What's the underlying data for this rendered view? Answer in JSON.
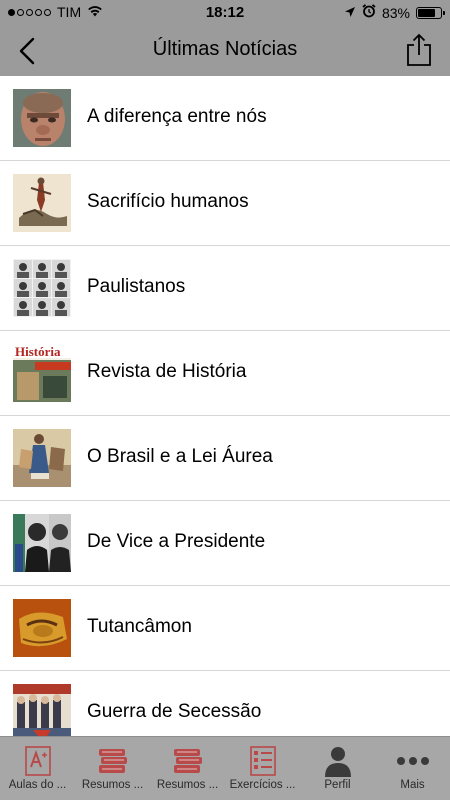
{
  "status_bar": {
    "carrier": "TIM",
    "time": "18:12",
    "battery_percent": "83%",
    "battery_level": 0.83,
    "signal_bars_filled": 1,
    "signal_bars_total": 5
  },
  "nav": {
    "title": "Últimas Notícias",
    "back_icon": "chevron-left-icon",
    "share_icon": "share-icon"
  },
  "news": [
    {
      "title": "A diferença entre nós",
      "thumb": "face-portrait"
    },
    {
      "title": "Sacrifício humanos",
      "thumb": "sacrifice-illustration"
    },
    {
      "title": "Paulistanos",
      "thumb": "portrait-grid"
    },
    {
      "title": "Revista de História",
      "thumb": "magazine-cover"
    },
    {
      "title": "O Brasil e a Lei Áurea",
      "thumb": "historical-painting"
    },
    {
      "title": "De Vice a Presidente",
      "thumb": "presidents-photos"
    },
    {
      "title": "Tutancâmon",
      "thumb": "golden-mask"
    },
    {
      "title": "Guerra de Secessão",
      "thumb": "civil-war-soldiers"
    }
  ],
  "tabs": [
    {
      "label": "Aulas do ...",
      "icon": "exam-icon"
    },
    {
      "label": "Resumos ...",
      "icon": "books-icon"
    },
    {
      "label": "Resumos ...",
      "icon": "books-icon"
    },
    {
      "label": "Exercícios ...",
      "icon": "checklist-icon"
    },
    {
      "label": "Perfil",
      "icon": "person-icon"
    },
    {
      "label": "Mais",
      "icon": "more-icon"
    }
  ],
  "colors": {
    "bar_background": "#9b9b9b",
    "tab_background": "#a7a7a7",
    "tab_icon_accent": "#b84a4a",
    "text": "#000000"
  }
}
